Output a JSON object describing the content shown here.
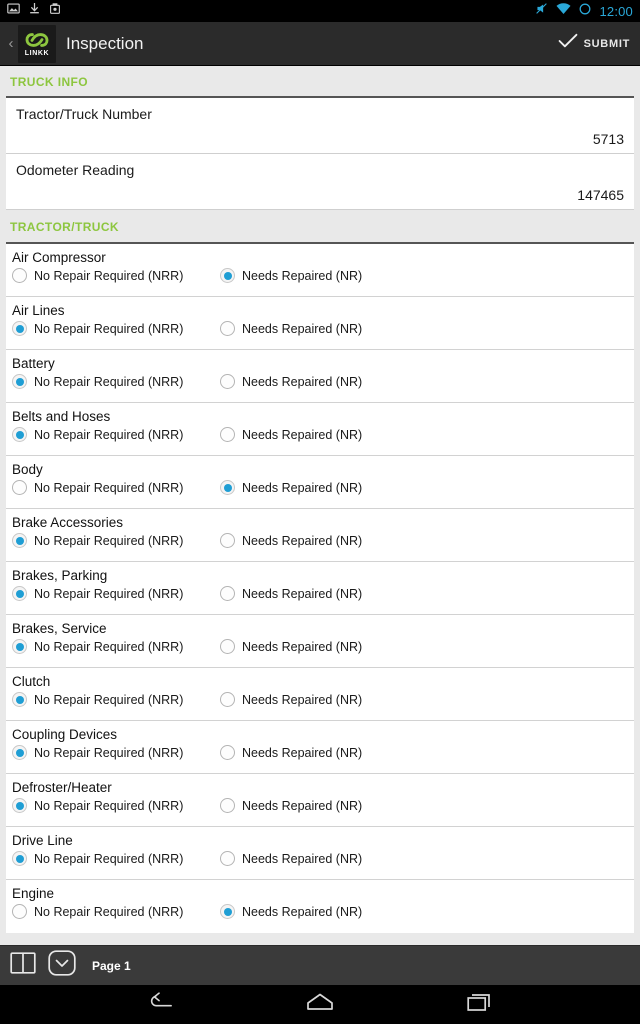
{
  "statusbar": {
    "time": "12:00",
    "left_icons": [
      "image-icon",
      "download-icon",
      "screenshot-icon"
    ],
    "right_icons": [
      "sound-muted-icon",
      "wifi-icon",
      "battery-icon"
    ]
  },
  "appbar": {
    "back_label": "‹",
    "logo_text": "LINKK",
    "title": "Inspection",
    "submit_label": "SUBMIT",
    "submit_icon": "check-icon"
  },
  "colors": {
    "accent_green": "#8dc63f",
    "radio_blue": "#1f9ed4",
    "appbar_bg": "#2b2b2b",
    "page_bg": "#e9e9e9",
    "status_blue": "#2aa8d8"
  },
  "sections": [
    {
      "heading": "TRUCK INFO",
      "fields": [
        {
          "label": "Tractor/Truck Number",
          "value": "5713"
        },
        {
          "label": "Odometer Reading",
          "value": "147465"
        }
      ]
    },
    {
      "heading": "TRACTOR/TRUCK",
      "option_labels": {
        "nrr": "No Repair Required (NRR)",
        "nr": "Needs Repaired (NR)"
      },
      "items": [
        {
          "name": "Air Compressor",
          "selected": "nr"
        },
        {
          "name": "Air Lines",
          "selected": "nrr"
        },
        {
          "name": "Battery",
          "selected": "nrr"
        },
        {
          "name": "Belts and Hoses",
          "selected": "nrr"
        },
        {
          "name": "Body",
          "selected": "nr"
        },
        {
          "name": "Brake Accessories",
          "selected": "nrr"
        },
        {
          "name": "Brakes, Parking",
          "selected": "nrr"
        },
        {
          "name": "Brakes, Service",
          "selected": "nrr"
        },
        {
          "name": "Clutch",
          "selected": "nrr"
        },
        {
          "name": "Coupling Devices",
          "selected": "nrr"
        },
        {
          "name": "Defroster/Heater",
          "selected": "nrr"
        },
        {
          "name": "Drive Line",
          "selected": "nrr"
        },
        {
          "name": "Engine",
          "selected": "nr"
        }
      ]
    }
  ],
  "bottombar": {
    "book_icon": "book-pages-icon",
    "complete_icon": "chevron-down-rounded-icon",
    "page_label": "Page 1"
  },
  "navbar": {
    "back_icon": "nav-back-icon",
    "home_icon": "nav-home-icon",
    "recents_icon": "nav-recents-icon"
  }
}
